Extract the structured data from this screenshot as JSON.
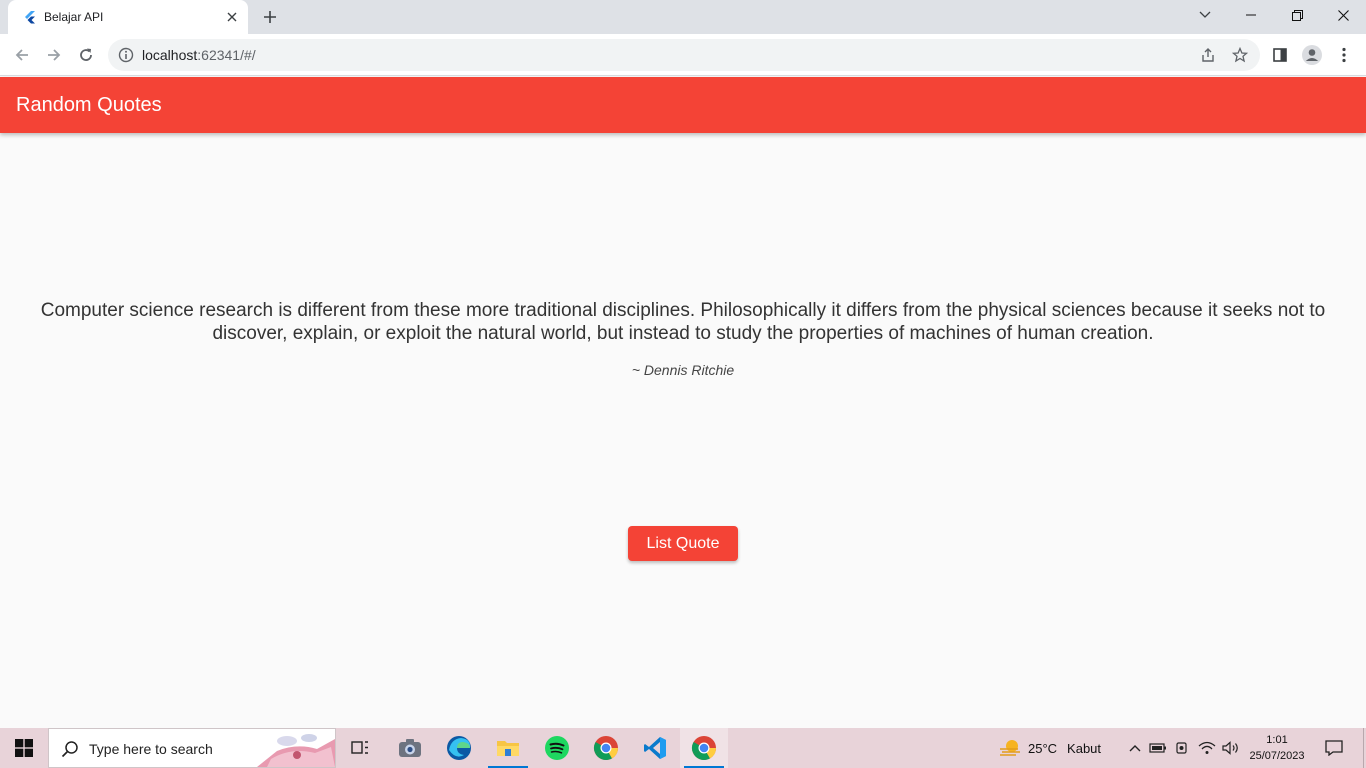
{
  "browser": {
    "tab_title": "Belajar API",
    "url_host": "localhost",
    "url_rest": ":62341/#/"
  },
  "app": {
    "title": "Random Quotes",
    "quote": "Computer science research is different from these more traditional disciplines. Philosophically it differs from the physical sciences because it seeks not to discover, explain, or exploit the natural world, but instead to study the properties of machines of human creation.",
    "author": "~ Dennis Ritchie",
    "button_label": "List Quote",
    "accent_color": "#f44336"
  },
  "taskbar": {
    "search_placeholder": "Type here to search",
    "weather_temp": "25°C",
    "weather_desc": "Kabut",
    "time": "1:01",
    "date": "25/07/2023",
    "pinned_apps": [
      "task-view",
      "camera",
      "edge",
      "file-explorer",
      "spotify",
      "chrome",
      "vscode",
      "chrome"
    ]
  }
}
